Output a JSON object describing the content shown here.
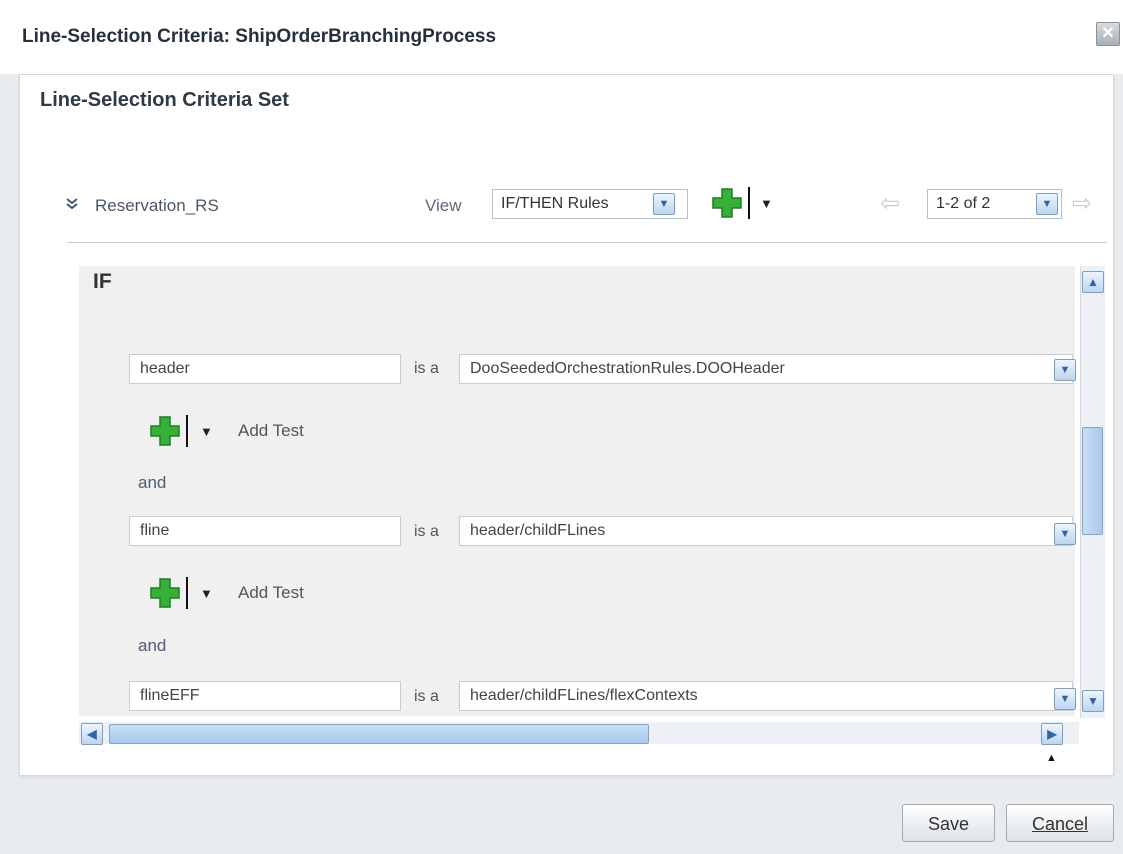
{
  "dialog": {
    "title": "Line-Selection Criteria: ShipOrderBranchingProcess",
    "close_glyph": "✕"
  },
  "panel": {
    "title": "Line-Selection Criteria Set"
  },
  "ruleset": {
    "name": "Reservation_RS",
    "collapse_glyph": "⌄⌄",
    "view_label": "View",
    "view_selected": "IF/THEN Rules",
    "pagination": "1-2 of 2"
  },
  "rule": {
    "if_label": "IF",
    "is_a": "is a",
    "and_label": "and",
    "add_test_label": "Add Test",
    "conditions": [
      {
        "variable": "header",
        "type": "DooSeededOrchestrationRules.DOOHeader"
      },
      {
        "variable": "fline",
        "type": "header/childFLines"
      },
      {
        "variable": "flineEFF",
        "type": "header/childFLines/flexContexts"
      }
    ]
  },
  "footer": {
    "save_label": "Save",
    "cancel_label": "Cancel"
  },
  "colors": {
    "accent_plus": "#2fa12f",
    "scroll_thumb": "#a9c8ea"
  }
}
